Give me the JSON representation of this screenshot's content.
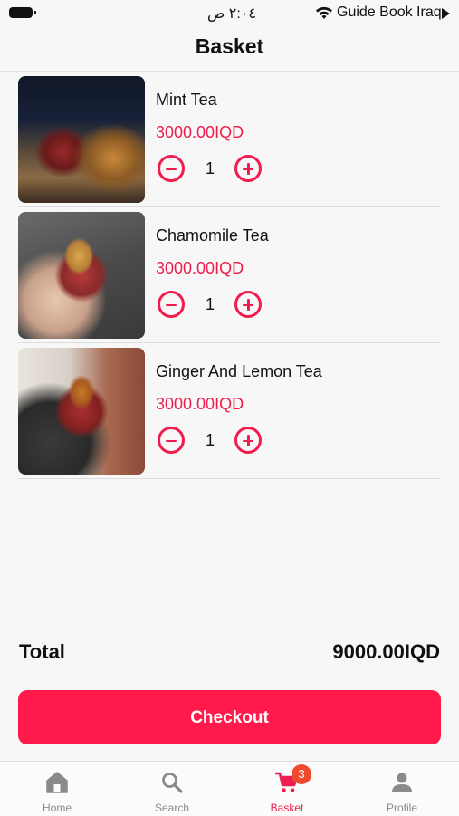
{
  "status_bar": {
    "time": "٢:٠٤ ص",
    "carrier": "Guide Book Iraq"
  },
  "header": {
    "title": "Basket"
  },
  "basket": {
    "items": [
      {
        "name": "Mint Tea",
        "price": "3000.00IQD",
        "quantity": "1"
      },
      {
        "name": "Chamomile Tea",
        "price": "3000.00IQD",
        "quantity": "1"
      },
      {
        "name": "Ginger And Lemon Tea",
        "price": "3000.00IQD",
        "quantity": "1"
      }
    ]
  },
  "summary": {
    "total_label": "Total",
    "total_value": "9000.00IQD"
  },
  "checkout": {
    "label": "Checkout"
  },
  "tabbar": {
    "tabs": [
      {
        "label": "Home",
        "icon": "home-icon"
      },
      {
        "label": "Search",
        "icon": "search-icon"
      },
      {
        "label": "Basket",
        "icon": "cart-icon",
        "badge": "3"
      },
      {
        "label": "Profile",
        "icon": "person-icon"
      }
    ],
    "active": "Basket"
  },
  "colors": {
    "accent": "#ef1d4f",
    "checkout_bg": "#ff1a4b",
    "badge_bg": "#f04a2e"
  }
}
